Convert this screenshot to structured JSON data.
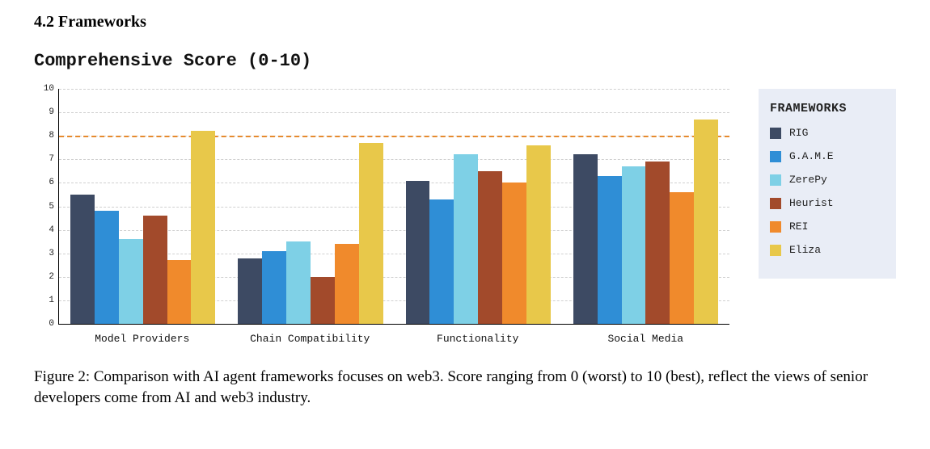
{
  "heading": "4.2   Frameworks",
  "caption": "Figure 2: Comparison with AI agent frameworks focuses on web3. Score ranging from 0 (worst) to 10 (best), reflect the views of senior developers come from AI and web3 industry.",
  "legend_title": "FRAMEWORKS",
  "chart_data": {
    "type": "bar",
    "title": "Comprehensive Score (0-10)",
    "xlabel": "",
    "ylabel": "",
    "ylim": [
      0,
      10
    ],
    "yticks": [
      0,
      1,
      2,
      3,
      4,
      5,
      6,
      7,
      8,
      9,
      10
    ],
    "reference_line": 8,
    "categories": [
      "Model Providers",
      "Chain Compatibility",
      "Functionality",
      "Social Media"
    ],
    "series": [
      {
        "name": "RIG",
        "color": "#3d4a63",
        "values": [
          5.5,
          2.8,
          6.1,
          7.2
        ]
      },
      {
        "name": "G.A.M.E",
        "color": "#2f8ed6",
        "values": [
          4.8,
          3.1,
          5.3,
          6.3
        ]
      },
      {
        "name": "ZerePy",
        "color": "#7ed0e6",
        "values": [
          3.6,
          3.5,
          7.2,
          6.7
        ]
      },
      {
        "name": "Heurist",
        "color": "#a24a2b",
        "values": [
          4.6,
          2.0,
          6.5,
          6.9
        ]
      },
      {
        "name": "REI",
        "color": "#f08a2c",
        "values": [
          2.7,
          3.4,
          6.0,
          5.6
        ]
      },
      {
        "name": "Eliza",
        "color": "#e8c84a",
        "values": [
          8.2,
          7.7,
          7.6,
          8.7
        ]
      }
    ]
  }
}
